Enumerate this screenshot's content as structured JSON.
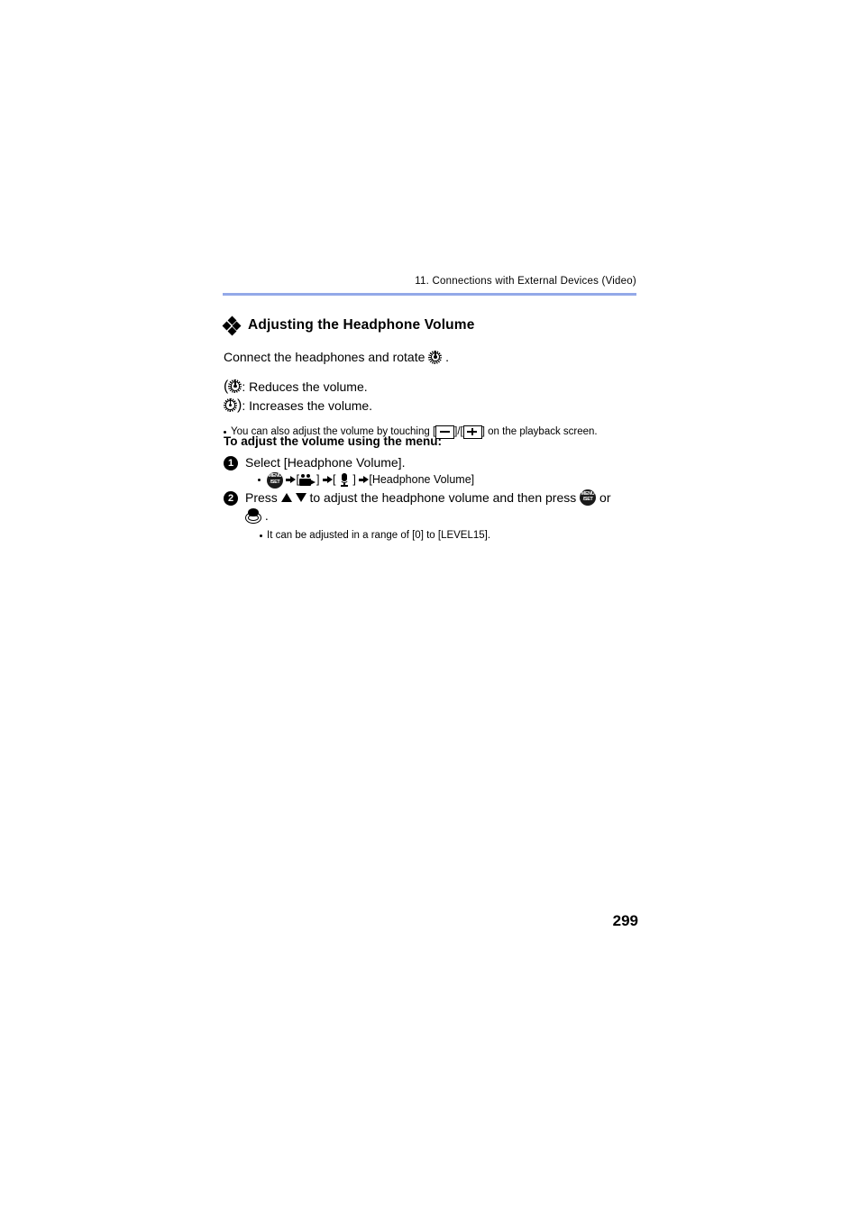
{
  "document": {
    "header_text": "11. Connections with External Devices (Video)",
    "rule_color": "#93a9e8",
    "page_number": "299"
  },
  "section": {
    "bullet_icon": "diamond-cluster-icon",
    "title": "Adjusting the Headphone Volume"
  },
  "body": {
    "connect_prefix": "Connect the headphones and rotate ",
    "connect_suffix": " .",
    "reduce": {
      "open_paren": "(",
      "icon": "rear-dial-icon",
      "text": ": Reduces the volume."
    },
    "increase": {
      "icon": "rear-dial-icon",
      "close_paren": ")",
      "text": ": Increases the volume."
    },
    "touch_note": {
      "prefix": "You can also adjust the volume by touching [",
      "minus_icon": "minus-button-icon",
      "separator": "]/[",
      "plus_icon": "plus-button-icon",
      "suffix": "] on the playback screen."
    }
  },
  "menu_section": {
    "subheading": "To adjust the volume using the menu:",
    "steps": [
      {
        "number": "❶",
        "text": "Select [Headphone Volume].",
        "path": {
          "menu_icon": "menu-set-icon",
          "arrow1": "arrow-right-icon",
          "bracket_open_1": "[",
          "video_icon": "video-camera-icon",
          "bracket_close_1": "]",
          "arrow2": "arrow-right-icon",
          "bracket_open_2": "[",
          "mic_icon": "microphone-icon",
          "bracket_close_2": "]",
          "arrow3": "arrow-right-icon",
          "target": "[Headphone Volume]"
        }
      },
      {
        "number": "❷",
        "text_before": "Press ",
        "up_icon": "triangle-up-icon",
        "down_icon": "triangle-down-icon",
        "text_middle": " to adjust the headphone volume and then press ",
        "menu_icon": "menu-set-icon",
        "text_or": " or",
        "joystick_icon": "joystick-icon",
        "period": " .",
        "note": "It can be adjusted in a range of [0] to [LEVEL15]."
      }
    ]
  }
}
